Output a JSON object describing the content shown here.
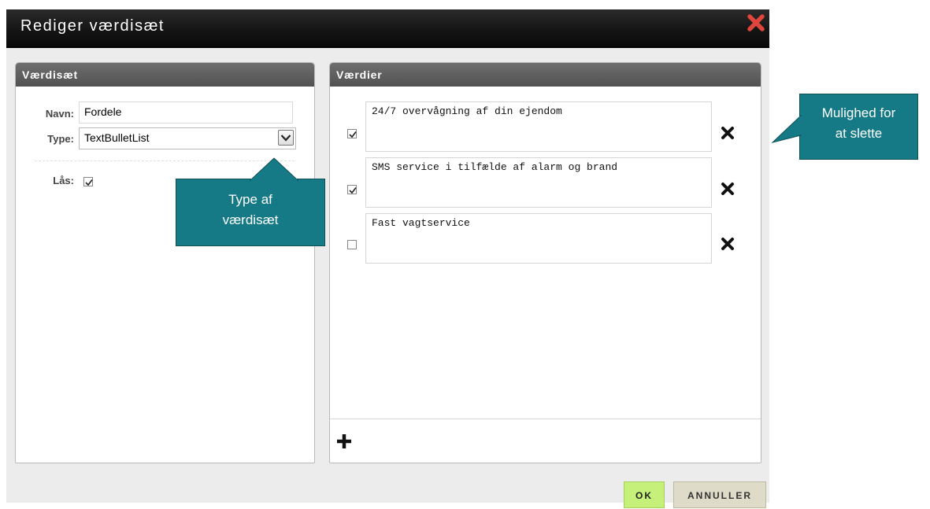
{
  "dialog": {
    "title": "Rediger værdisæt",
    "close_icon": "close-x-icon",
    "accent_close": "#e0453b"
  },
  "left_panel": {
    "heading": "Værdisæt",
    "name_label": "Navn:",
    "name_value": "Fordele",
    "type_label": "Type:",
    "type_value": "TextBulletList",
    "lock_label": "Lås:",
    "lock_checked": true
  },
  "right_panel": {
    "heading": "Værdier",
    "values": [
      {
        "text": "24/7 overvågning af din ejendom",
        "checked": true
      },
      {
        "text": "SMS service i tilfælde af alarm og brand",
        "checked": true
      },
      {
        "text": "Fast vagtservice",
        "checked": false
      }
    ],
    "delete_icon": "x-delete-icon",
    "add_icon": "plus-icon"
  },
  "buttons": {
    "ok": "OK",
    "cancel": "ANNULLER",
    "ok_color": "#c5f07a"
  },
  "callouts": {
    "type_line1": "Type af",
    "type_line2": "værdisæt",
    "delete_line1": "Mulighed for",
    "delete_line2": "at slette",
    "color": "#157a86"
  }
}
